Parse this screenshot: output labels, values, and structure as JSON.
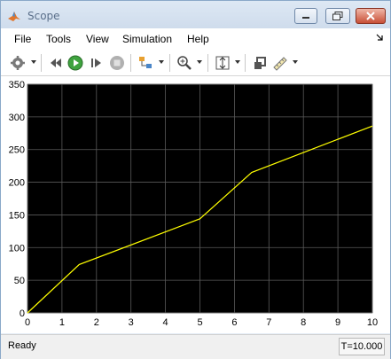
{
  "window": {
    "title": "Scope",
    "icon": "matlab-icon"
  },
  "menubar": {
    "items": [
      "File",
      "Tools",
      "View",
      "Simulation",
      "Help"
    ],
    "overflow_icon": "dock-arrow-icon"
  },
  "toolbar": {
    "icons": [
      "settings-icon",
      "step-back-icon",
      "run-icon",
      "step-forward-icon",
      "stop-icon",
      "signal-selector-icon",
      "zoom-in-icon",
      "autoscale-icon",
      "highlight-icon",
      "measurements-icon"
    ]
  },
  "chart_data": {
    "type": "line",
    "title": "",
    "xlabel": "",
    "ylabel": "",
    "xlim": [
      0,
      10
    ],
    "ylim": [
      0,
      350
    ],
    "xticks": [
      "0",
      "1",
      "2",
      "3",
      "4",
      "5",
      "6",
      "7",
      "8",
      "9",
      "10"
    ],
    "yticks": [
      "0",
      "50",
      "100",
      "150",
      "200",
      "250",
      "300",
      "350"
    ],
    "grid": true,
    "background": "#000000",
    "axes_color": "#c0c0c0",
    "series": [
      {
        "color": "#ffff00",
        "x": [
          0,
          1.5,
          5,
          6.5,
          10
        ],
        "y": [
          0,
          74,
          144,
          215,
          286
        ]
      }
    ]
  },
  "statusbar": {
    "state": "Ready",
    "time": "T=10.000"
  }
}
